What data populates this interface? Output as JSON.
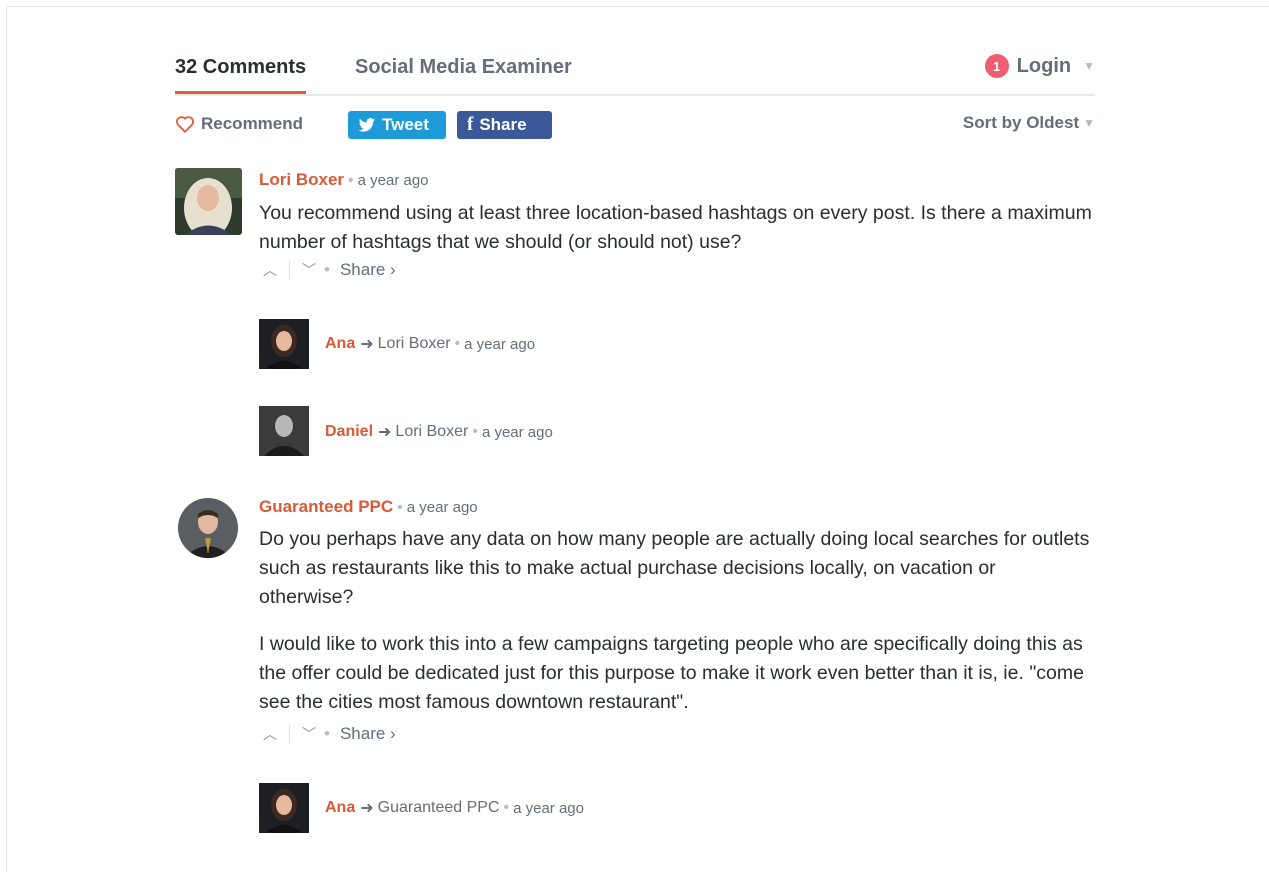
{
  "nav": {
    "comments_tab": "32 Comments",
    "community_tab": "Social Media Examiner",
    "notification_count": "1",
    "login_label": "Login"
  },
  "actions": {
    "recommend_label": "Recommend",
    "tweet_label": "Tweet",
    "share_label": "Share",
    "sort_label": "Sort by Oldest"
  },
  "comments": [
    {
      "author": "Lori Boxer",
      "time": "a year ago",
      "body": [
        "You recommend using at least three location-based hashtags on every post. Is there a maximum number of hashtags that we should (or should not) use?"
      ],
      "share": "Share ›",
      "replies": [
        {
          "author": "Ana",
          "target": "Lori Boxer",
          "time": "a year ago"
        },
        {
          "author": "Daniel",
          "target": "Lori Boxer",
          "time": "a year ago"
        }
      ]
    },
    {
      "author": "Guaranteed PPC",
      "time": "a year ago",
      "body": [
        "Do you perhaps have any data on how many people are actually doing local searches for outlets such as restaurants like this to make actual purchase decisions locally, on vacation or otherwise?",
        "I would like to work this into a few campaigns targeting people who are specifically doing this as the offer could be dedicated just for this purpose to make it work even better than it is, ie. \"come see the cities most famous downtown restaurant\"."
      ],
      "share": "Share ›",
      "replies": [
        {
          "author": "Ana",
          "target": "Guaranteed PPC",
          "time": "a year ago"
        }
      ]
    }
  ],
  "colors": {
    "accent": "#e05a3c",
    "author": "#d85a36",
    "twitter": "#1d9bd8",
    "facebook": "#3b5998",
    "badge": "#f05f70"
  }
}
